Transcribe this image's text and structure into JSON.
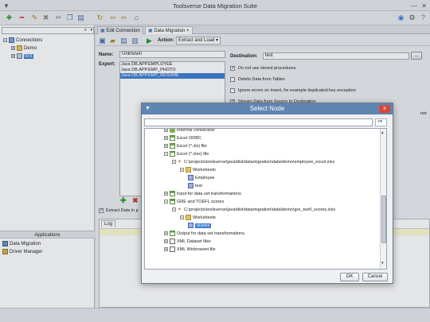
{
  "window": {
    "title": "Toolsverse Data Migration Suite"
  },
  "left_panel": {
    "tree": [
      {
        "label": "Connections"
      },
      {
        "label": "Demo"
      },
      {
        "label": "test"
      }
    ],
    "apps_header": "Applications",
    "apps": [
      {
        "label": "Data Migration"
      },
      {
        "label": "Driver Manager"
      }
    ]
  },
  "tabs": [
    {
      "label": "Edit Connection"
    },
    {
      "label": "Data Migration"
    }
  ],
  "doc_toolbar": {
    "action_label": "Action:",
    "action_value": "Extract and Load"
  },
  "form": {
    "name_label": "Name:",
    "name_value": "Unknown",
    "export_label": "Export:",
    "export_items": [
      "Java DB.APP.EMPLOYEE",
      "Java DB.APP.EMP_PHOTO",
      "Java DB.APP.EMP_RESUME"
    ],
    "destination_label": "Destination:",
    "destination_value": "test",
    "ellipsis": "...",
    "options": [
      {
        "label": "Do not use stored procedures",
        "checked": true
      },
      {
        "label": "Delete Data from Tables",
        "checked": false
      },
      {
        "label": "Ignore errors on insert, for example duplicated key exception",
        "checked": false
      },
      {
        "label": "Stream Data from Source to Destination",
        "checked": true
      }
    ],
    "trailing_text": "not",
    "extract_checkbox": "Extract Data in p"
  },
  "log": {
    "tab_label": "Log"
  },
  "dialog": {
    "title": "Select Node",
    "close_glyph": "x",
    "nodes": [
      {
        "label": "Informix connection",
        "depth": 1,
        "icon": "db"
      },
      {
        "label": "Excel ODBC",
        "depth": 1,
        "icon": "sheet"
      },
      {
        "label": "Excel (*.xls) file",
        "depth": 1,
        "icon": "sheet"
      },
      {
        "label": "Excel (*.xlsx) file",
        "depth": 1,
        "icon": "sheet"
      },
      {
        "label": "C:\\projects\\toolsverse\\java\\dist\\datamigration\\data\\demo\\employee_excel.xlsx",
        "depth": 2,
        "icon": "file"
      },
      {
        "label": "Worksheets",
        "depth": 3,
        "icon": "folder"
      },
      {
        "label": "Employee",
        "depth": 4,
        "icon": "table"
      },
      {
        "label": "test",
        "depth": 4,
        "icon": "table"
      },
      {
        "label": "Input for data set transformations",
        "depth": 1,
        "icon": "sheet"
      },
      {
        "label": "GRE and TOEFL scores",
        "depth": 1,
        "icon": "sheet"
      },
      {
        "label": "C:\\projects\\toolsverse\\java\\dist\\datamigration\\data\\demo\\gre_toefl_scores.xlsx",
        "depth": 2,
        "icon": "file"
      },
      {
        "label": "Worksheets",
        "depth": 3,
        "icon": "folder"
      },
      {
        "label": "scores",
        "depth": 4,
        "icon": "table",
        "selected": true
      },
      {
        "label": "Output for data set transformations",
        "depth": 1,
        "icon": "sheet"
      },
      {
        "label": "XML Dataset files",
        "depth": 1,
        "icon": "xml"
      },
      {
        "label": "XML Webrowset file",
        "depth": 1,
        "icon": "xml"
      }
    ],
    "ok_label": "OK",
    "cancel_label": "Cancel"
  },
  "colors": {
    "accent": "#3f7fd1",
    "selection": "#3f7fd1",
    "dialog_title": "#5f86b2",
    "close": "#d8453a"
  }
}
